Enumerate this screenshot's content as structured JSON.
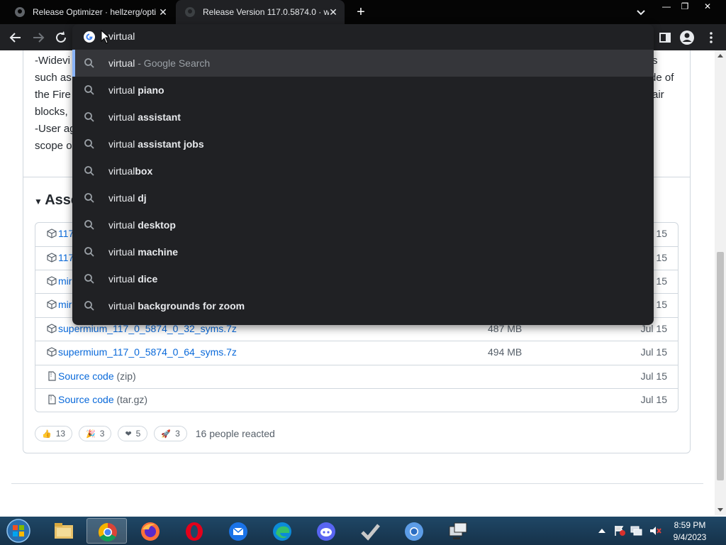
{
  "browser": {
    "tabs": [
      {
        "title": "Release Optimizer · hellzerg/opti",
        "active": false
      },
      {
        "title": "Release Version 117.0.5874.0 · wi",
        "active": true
      }
    ],
    "new_tab_symbol": "+",
    "omnibox_text": "virtual"
  },
  "omnibox_suggestions": [
    {
      "prefix": "virtual",
      "completion": "",
      "suffix": " - Google Search"
    },
    {
      "prefix": "virtual ",
      "completion": "piano",
      "suffix": ""
    },
    {
      "prefix": "virtual ",
      "completion": "assistant",
      "suffix": ""
    },
    {
      "prefix": "virtual ",
      "completion": "assistant jobs",
      "suffix": ""
    },
    {
      "prefix": "virtual",
      "completion": "box",
      "suffix": ""
    },
    {
      "prefix": "virtual ",
      "completion": "dj",
      "suffix": ""
    },
    {
      "prefix": "virtual ",
      "completion": "desktop",
      "suffix": ""
    },
    {
      "prefix": "virtual ",
      "completion": "machine",
      "suffix": ""
    },
    {
      "prefix": "virtual ",
      "completion": "dice",
      "suffix": ""
    },
    {
      "prefix": "virtual ",
      "completion": "backgrounds for zoom",
      "suffix": ""
    }
  ],
  "release_description": {
    "left_fragments": [
      "-Widevi",
      "such as",
      "the Fire",
      "blocks,",
      "-User ag",
      "scope o"
    ],
    "right_fragments": [
      "s",
      "de of",
      "air"
    ]
  },
  "assets": {
    "heading": "Asse",
    "rows": [
      {
        "name": "117",
        "name_suffix": "",
        "size": "",
        "date": "15"
      },
      {
        "name": "117",
        "name_suffix": "",
        "size": "",
        "date": "15"
      },
      {
        "name": "mir",
        "name_suffix": "",
        "size": "",
        "date": "15"
      },
      {
        "name": "mir",
        "name_suffix": "",
        "size": "",
        "date": "15"
      },
      {
        "name": "supermium_117_0_5874_0_32_syms.7z",
        "name_suffix": "",
        "size": "487 MB",
        "date": "Jul 15"
      },
      {
        "name": "supermium_117_0_5874_0_64_syms.7z",
        "name_suffix": "",
        "size": "494 MB",
        "date": "Jul 15"
      },
      {
        "name": "Source code",
        "name_suffix": " (zip)",
        "size": "",
        "date": "Jul 15"
      },
      {
        "name": "Source code",
        "name_suffix": " (tar.gz)",
        "size": "",
        "date": "Jul 15"
      }
    ]
  },
  "reactions": {
    "items": [
      {
        "emoji": "👍",
        "count": "13"
      },
      {
        "emoji": "🎉",
        "count": "3"
      },
      {
        "emoji": "❤",
        "count": "5"
      },
      {
        "emoji": "🚀",
        "count": "3"
      }
    ],
    "summary": "16 people reacted"
  },
  "taskbar": {
    "time": "8:59 PM",
    "date": "9/4/2023"
  },
  "colors": {
    "omnibox_bg": "#202124",
    "link_blue": "#0969da",
    "accent_blue": "#8ab4f8"
  }
}
